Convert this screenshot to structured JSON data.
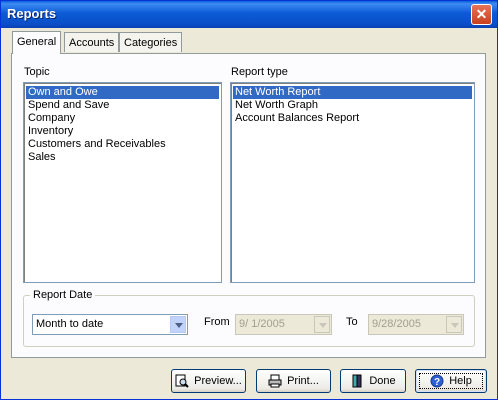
{
  "window": {
    "title": "Reports",
    "close_glyph": "✕"
  },
  "tabs": [
    {
      "label": "General",
      "active": true
    },
    {
      "label": "Accounts",
      "active": false
    },
    {
      "label": "Categories",
      "active": false
    }
  ],
  "topic": {
    "label": "Topic",
    "items": [
      "Own and Owe",
      "Spend and Save",
      "Company",
      "Inventory",
      "Customers and Receivables",
      "Sales"
    ],
    "selected": "Own and Owe"
  },
  "report_type": {
    "label": "Report type",
    "items": [
      "Net Worth Report",
      "Net Worth Graph",
      "Account Balances Report"
    ],
    "selected": "Net Worth Report"
  },
  "report_date": {
    "group_label": "Report Date",
    "range": "Month to date",
    "from_label": "From",
    "from_value": "9/ 1/2005",
    "to_label": "To",
    "to_value": "9/28/2005"
  },
  "buttons": {
    "preview": "Preview...",
    "print": "Print...",
    "done": "Done",
    "help": "Help"
  },
  "icons": [
    "preview-icon",
    "print-icon",
    "done-icon",
    "help-icon"
  ],
  "colors": {
    "selection": "#316ac5",
    "titlebar": "#0a5fd8"
  }
}
